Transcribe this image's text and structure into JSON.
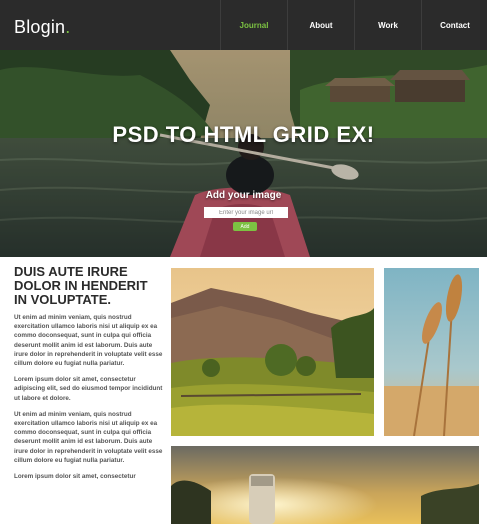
{
  "header": {
    "logo_text": "Blogin",
    "logo_dot": ".",
    "nav": [
      {
        "label": "Journal",
        "active": true
      },
      {
        "label": "About",
        "active": false
      },
      {
        "label": "Work",
        "active": false
      },
      {
        "label": "Contact",
        "active": false
      }
    ]
  },
  "hero": {
    "title": "PSD TO HTML GRID EX!",
    "subtitle": "Add your image",
    "input_placeholder": "Enter your image url",
    "button_label": "Add"
  },
  "content": {
    "heading": "DUIS AUTE IRURE DOLOR IN HENDERIT IN VOLUPTATE.",
    "paragraphs": [
      "Ut enim ad minim veniam, quis nostrud exercitation ullamco laboris nisi ut aliquip ex ea commo doconsequat, sunt in culpa qui officia deserunt mollit anim id est laborum. Duis aute irure dolor in reprehenderit in voluptate velit esse cillum dolore eu fugiat nulla pariatur.",
      "Lorem ipsum dolor sit amet, consectetur adipiscing elit, sed do eiusmod tempor incididunt ut labore et dolore.",
      "Ut enim ad minim veniam, quis nostrud exercitation ullamco laboris nisi ut aliquip ex ea commo doconsequat, sunt in culpa qui officia deserunt mollit anim id est laborum. Duis aute irure dolor in reprehenderit in voluptate velit esse cillum dolore eu fugiat nulla pariatur.",
      "Lorem ipsum dolor sit amet, consectetur"
    ]
  },
  "colors": {
    "header_bg": "#2b2b2b",
    "accent": "#7cc242"
  }
}
